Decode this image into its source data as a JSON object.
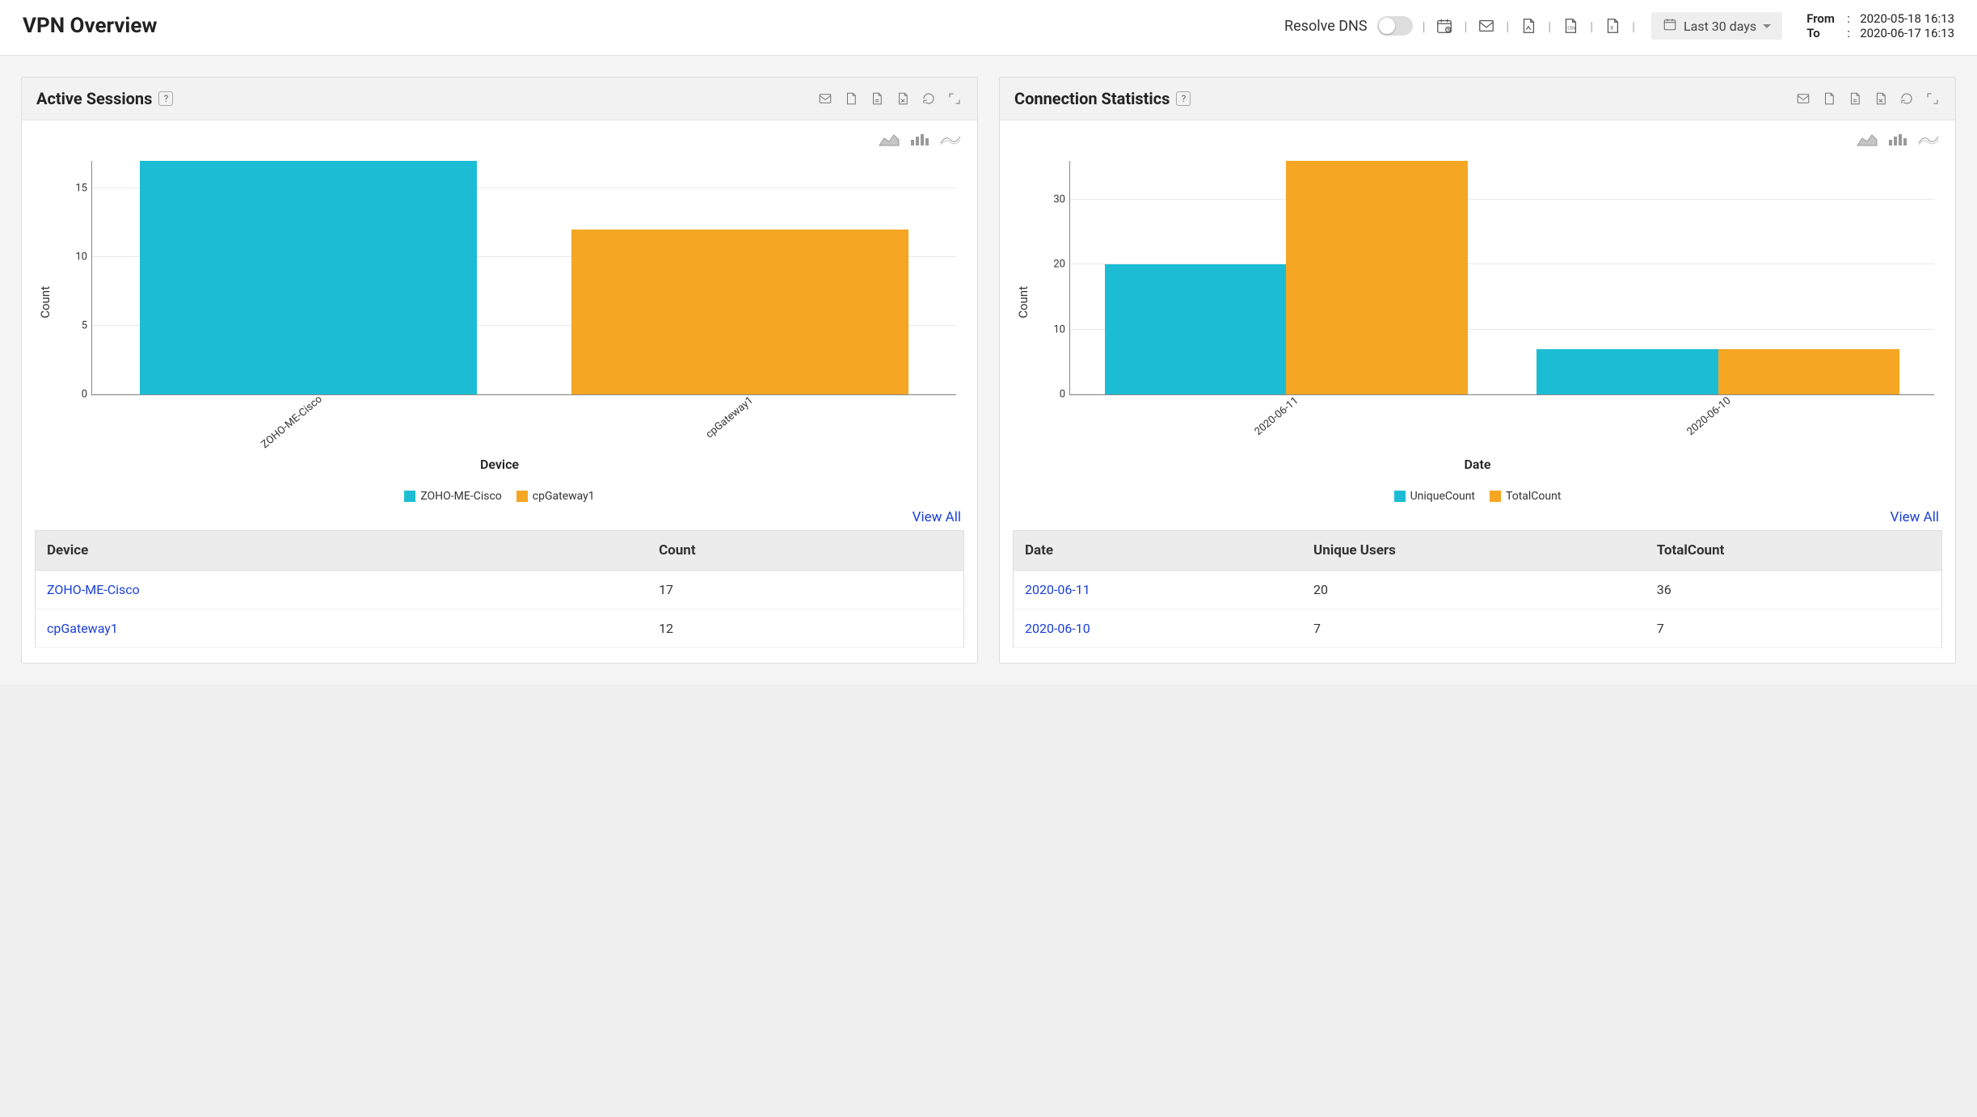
{
  "header": {
    "title": "VPN Overview",
    "resolve_dns_label": "Resolve DNS",
    "date_range_label": "Last 30 days",
    "from_label": "From",
    "to_label": "To",
    "from_value": "2020-05-18 16:13",
    "to_value": "2020-06-17 16:13"
  },
  "colors": {
    "series1": "#1cbdd4",
    "series2": "#f5a623"
  },
  "panels": {
    "active_sessions": {
      "title": "Active Sessions",
      "xlabel": "Device",
      "ylabel": "Count",
      "legend": [
        "ZOHO-ME-Cisco",
        "cpGateway1"
      ],
      "view_all": "View All",
      "table": {
        "columns": [
          "Device",
          "Count"
        ],
        "rows": [
          {
            "device": "ZOHO-ME-Cisco",
            "count": 17
          },
          {
            "device": "cpGateway1",
            "count": 12
          }
        ]
      }
    },
    "connection_stats": {
      "title": "Connection Statistics",
      "xlabel": "Date",
      "ylabel": "Count",
      "legend": [
        "UniqueCount",
        "TotalCount"
      ],
      "view_all": "View All",
      "table": {
        "columns": [
          "Date",
          "Unique Users",
          "TotalCount"
        ],
        "rows": [
          {
            "date": "2020-06-11",
            "unique": 20,
            "total": 36
          },
          {
            "date": "2020-06-10",
            "unique": 7,
            "total": 7
          }
        ]
      }
    }
  },
  "chart_data": [
    {
      "type": "bar",
      "title": "Active Sessions",
      "xlabel": "Device",
      "ylabel": "Count",
      "categories": [
        "ZOHO-ME-Cisco",
        "cpGateway1"
      ],
      "values": [
        17,
        12
      ],
      "series_colors": [
        "#1cbdd4",
        "#f5a623"
      ],
      "ylim": [
        0,
        17
      ],
      "yticks": [
        0,
        5,
        10,
        15
      ]
    },
    {
      "type": "bar",
      "title": "Connection Statistics",
      "xlabel": "Date",
      "ylabel": "Count",
      "categories": [
        "2020-06-11",
        "2020-06-10"
      ],
      "series": [
        {
          "name": "UniqueCount",
          "values": [
            20,
            7
          ],
          "color": "#1cbdd4"
        },
        {
          "name": "TotalCount",
          "values": [
            36,
            7
          ],
          "color": "#f5a623"
        }
      ],
      "ylim": [
        0,
        36
      ],
      "yticks": [
        0,
        10,
        20,
        30
      ]
    }
  ]
}
